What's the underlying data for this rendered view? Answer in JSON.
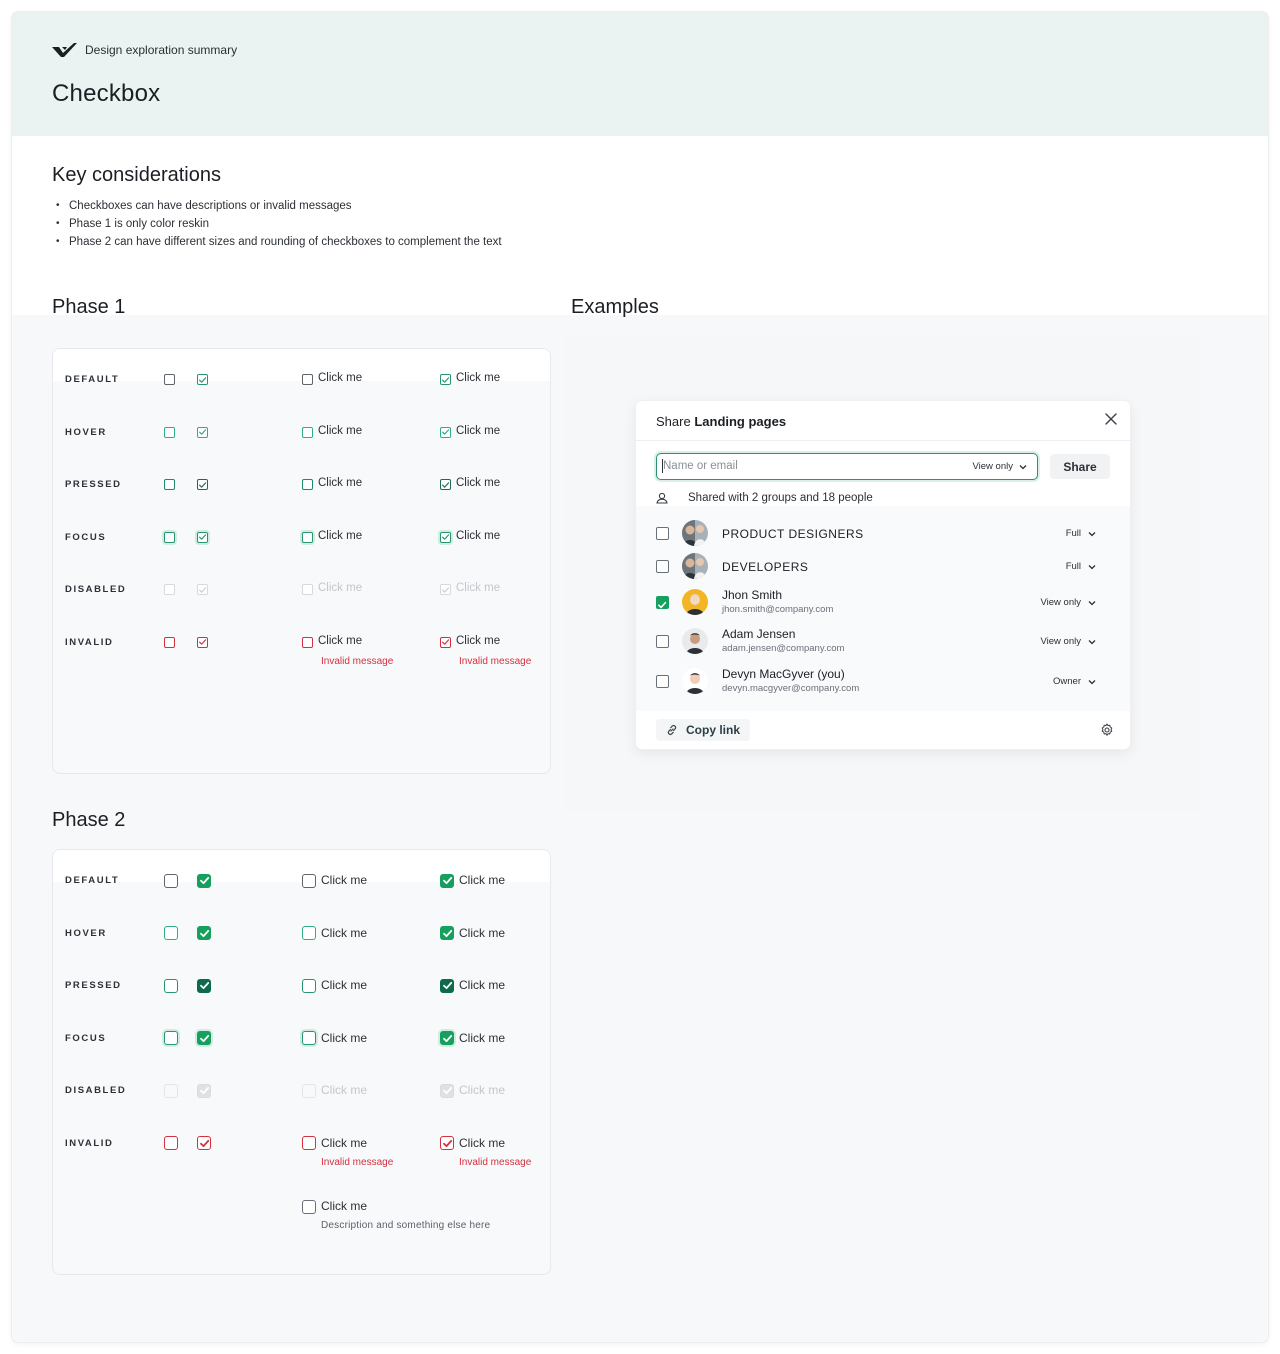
{
  "header": {
    "brand": "Design exploration summary",
    "title": "Checkbox"
  },
  "key_considerations": {
    "title": "Key considerations",
    "items": [
      "Checkboxes can have descriptions or invalid messages",
      "Phase 1 is only color reskin",
      "Phase 2 can have different sizes and rounding of checkboxes to complement the text"
    ]
  },
  "phase1": {
    "title": "Phase 1",
    "click_label": "Click me",
    "invalid_message": "Invalid message",
    "states": [
      "DEFAULT",
      "HOVER",
      "PRESSED",
      "FOCUS",
      "DISABLED",
      "INVALID"
    ]
  },
  "phase2": {
    "title": "Phase 2",
    "click_label": "Click me",
    "invalid_message": "Invalid message",
    "states": [
      "DEFAULT",
      "HOVER",
      "PRESSED",
      "FOCUS",
      "DISABLED",
      "INVALID"
    ],
    "extra_label": "Click me",
    "extra_description": "Description and something else here"
  },
  "examples": {
    "title": "Examples",
    "dialog": {
      "title_prefix": "Share",
      "title_bold": "Landing pages",
      "search_placeholder": "Name or email",
      "search_permission": "View only",
      "share_button": "Share",
      "shared_summary": "Shared with 2 groups and 18 people",
      "people": [
        {
          "name": "PRODUCT DESIGNERS",
          "email": "",
          "role": "Full",
          "checked": false
        },
        {
          "name": "DEVELOPERS",
          "email": "",
          "role": "Full",
          "checked": false
        },
        {
          "name": "Jhon Smith",
          "email": "jhon.smith@company.com",
          "role": "View only",
          "checked": true
        },
        {
          "name": "Adam Jensen",
          "email": "adam.jensen@company.com",
          "role": "View only",
          "checked": false
        },
        {
          "name": "Devyn MacGyver (you)",
          "email": "devyn.macgyver@company.com",
          "role": "Owner",
          "checked": false
        }
      ],
      "copy_link": "Copy link"
    }
  },
  "colors": {
    "accent_green": "#16a05d",
    "focus_green": "#2f8f73",
    "invalid_red": "#d4303f",
    "hero_bg": "#eaf3f1"
  }
}
